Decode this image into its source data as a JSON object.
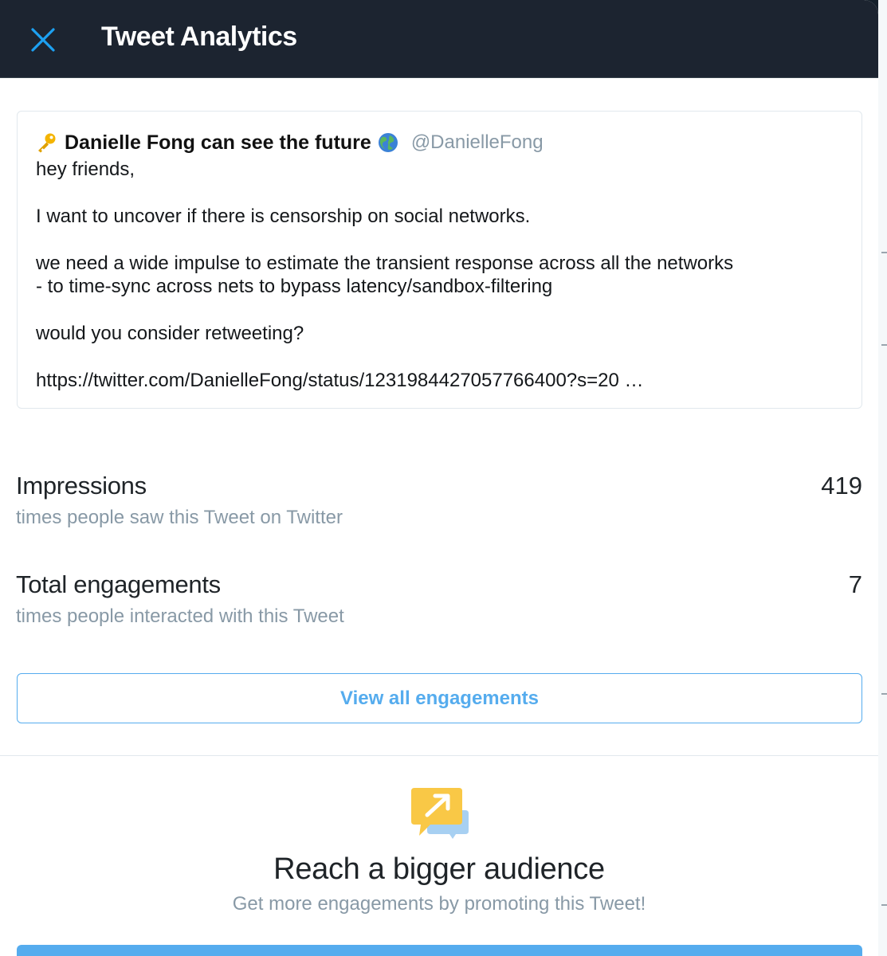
{
  "header": {
    "title": "Tweet Analytics",
    "close_icon": "close-icon"
  },
  "tweet": {
    "author_name": "Danielle Fong can see the future",
    "author_handle": "@DanielleFong",
    "name_prefix_icon": "key-icon",
    "name_suffix_icon": "globe-icon",
    "lines": [
      "hey friends,",
      "",
      "I want to uncover if there is censorship on social networks.",
      "",
      "we need a wide impulse to estimate the transient response across all the networks",
      "- to time-sync across nets to bypass latency/sandbox-filtering",
      "",
      "would you consider retweeting?",
      "",
      "https://twitter.com/DanielleFong/status/1231984427057766400?s=20 …"
    ]
  },
  "metrics": [
    {
      "label": "Impressions",
      "value": "419",
      "description": "times people saw this Tweet on Twitter"
    },
    {
      "label": "Total engagements",
      "value": "7",
      "description": "times people interacted with this Tweet"
    }
  ],
  "view_engagements_label": "View all engagements",
  "promo": {
    "icon": "promote-arrow-icon",
    "title": "Reach a bigger audience",
    "subtitle": "Get more engagements by promoting this Tweet!"
  },
  "colors": {
    "header_bg": "#1c2430",
    "accent": "#55acee",
    "muted_text": "#8899a6",
    "promo_icon_yellow": "#f9c846",
    "promo_icon_blue": "#a7d0f2"
  }
}
